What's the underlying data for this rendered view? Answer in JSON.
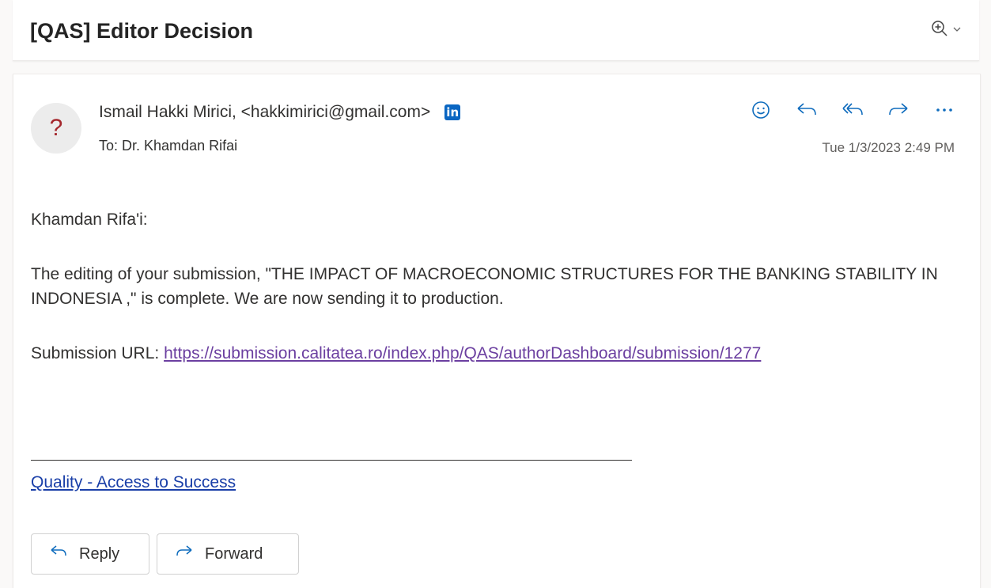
{
  "subject": {
    "title": "[QAS] Editor Decision",
    "icons": [
      "zoom-in-icon",
      "chevron-down-icon"
    ]
  },
  "message": {
    "avatar_glyph": "?",
    "from": "Ismail Hakki Mirici, <hakkimirici@gmail.com>",
    "linkedin_badge": "in",
    "to_prefix": "To:",
    "to": "Dr. Khamdan Rifai",
    "timestamp": "Tue 1/3/2023 2:49 PM",
    "actions": [
      "emoji-icon",
      "reply-icon",
      "reply-all-icon",
      "forward-icon",
      "more-icon"
    ]
  },
  "body": {
    "greeting": "Khamdan Rifa'i:",
    "paragraph": "The editing of your submission, \"THE IMPACT OF MACROECONOMIC STRUCTURES FOR THE BANKING STABILITY IN INDONESIA ,\" is complete. We are now sending it to production.",
    "url_label": "Submission URL:",
    "url": "https://submission.calitatea.ro/index.php/QAS/authorDashboard/submission/1277",
    "signature_link": "Quality - Access to Success"
  },
  "buttons": {
    "reply": "Reply",
    "forward": "Forward"
  },
  "colors": {
    "accent": "#0f6cbd",
    "link_visited": "#6b3fa0",
    "link": "#1a3fa8",
    "avatar_glyph": "#a4262c",
    "linkedin": "#0a66c2"
  }
}
